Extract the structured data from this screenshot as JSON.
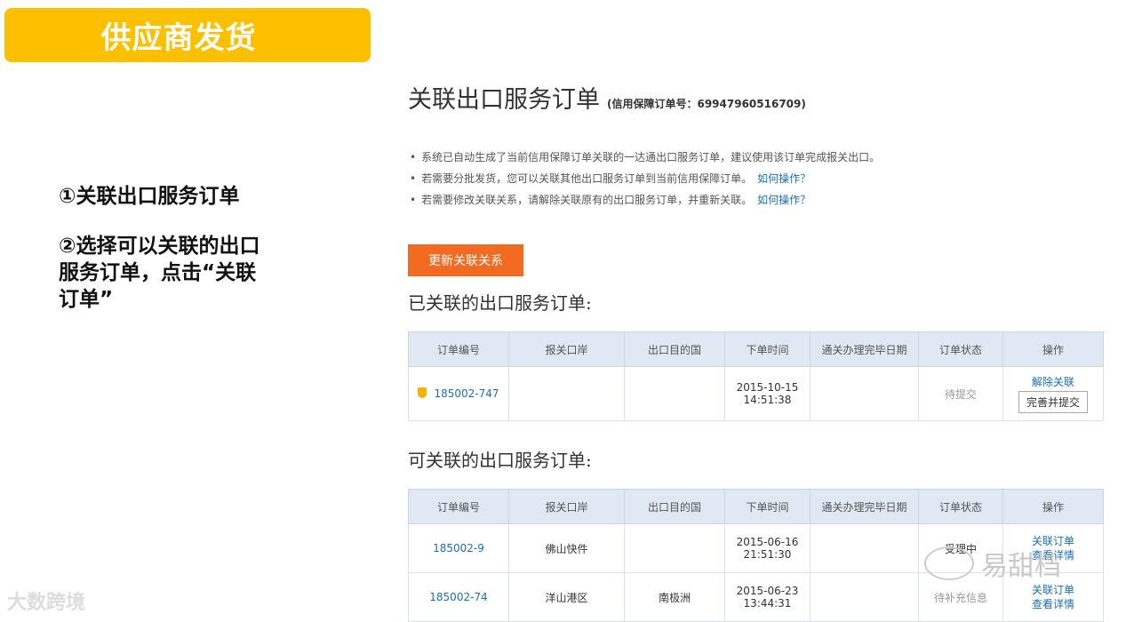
{
  "banner": {
    "title": "供应商发货"
  },
  "steps": {
    "step1": "①关联出口服务订单",
    "step2": "②选择可以关联的出口服务订单，点击“关联订单”"
  },
  "header": {
    "title": "关联出口服务订单",
    "guarantee_label": "(信用保障订单号：69947960516709)"
  },
  "notes": [
    {
      "text": "系统已自动生成了当前信用保障订单关联的一达通出口服务订单，建议使用该订单完成报关出口。",
      "link": ""
    },
    {
      "text": "若需要分批发货，您可以关联其他出口服务订单到当前信用保障订单。",
      "link": "如何操作？"
    },
    {
      "text": "若需要修改关联关系，请解除关联原有的出口服务订单，并重新关联。",
      "link": "如何操作？"
    }
  ],
  "update_button": "更新关联关系",
  "linked_section": {
    "title": "已关联的出口服务订单:",
    "columns": [
      "订单编号",
      "报关口岸",
      "出口目的国",
      "下单时间",
      "通关办理完毕日期",
      "订单状态",
      "操作"
    ],
    "rows": [
      {
        "order_no": "185002-747",
        "port": "",
        "country": "",
        "date": "2015-10-15",
        "time": "14:51:38",
        "clear_date": "",
        "status": "待提交",
        "op1": "解除关联",
        "op2": "完善并提交"
      }
    ]
  },
  "available_section": {
    "title": "可关联的出口服务订单:",
    "columns": [
      "订单编号",
      "报关口岸",
      "出口目的国",
      "下单时间",
      "通关办理完毕日期",
      "订单状态",
      "操作"
    ],
    "rows": [
      {
        "order_no": "185002-9",
        "port": "佛山快件",
        "country": "",
        "date": "2015-06-16",
        "time": "21:51:30",
        "clear_date": "",
        "status": "受理中",
        "op1": "关联订单",
        "op2": "查看详情"
      },
      {
        "order_no": "185002-74",
        "port": "洋山港区",
        "country": "南极洲",
        "date": "2015-06-23",
        "time": "13:44:31",
        "clear_date": "",
        "status": "待补充信息",
        "op1": "关联订单",
        "op2": "查看详情"
      }
    ]
  },
  "watermarks": {
    "left": "大数跨境",
    "right": "易甜档"
  }
}
